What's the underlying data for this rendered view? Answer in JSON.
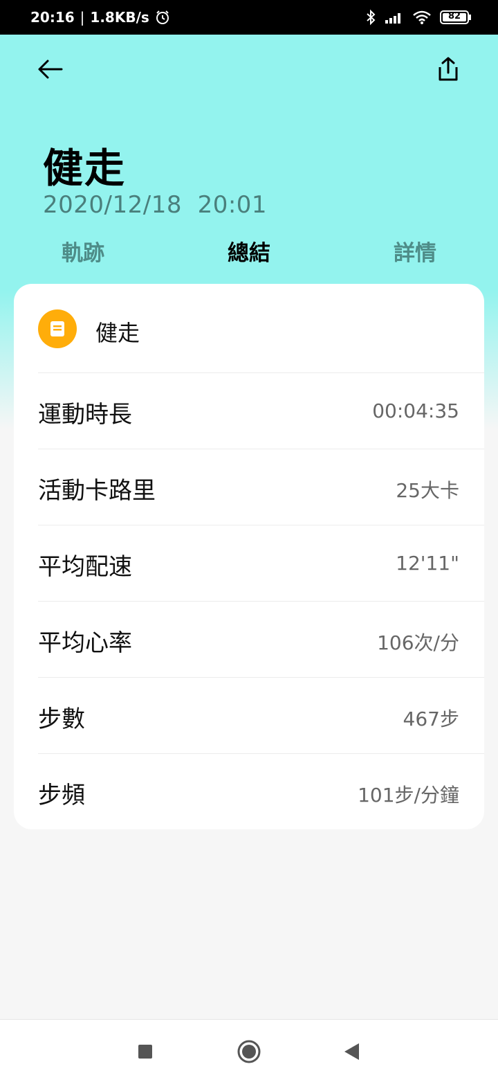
{
  "status_bar": {
    "time": "20:16",
    "separator": "|",
    "net_speed": "1.8KB/s",
    "battery": "82",
    "icons": [
      "alarm-icon",
      "bluetooth-icon",
      "signal-icon",
      "wifi-icon",
      "battery-icon"
    ]
  },
  "toolbar": {
    "back_icon": "arrow-left-icon",
    "share_icon": "share-icon"
  },
  "header": {
    "title": "健走",
    "datetime": "2020/12/18  20:01"
  },
  "tabs": [
    {
      "label": "軌跡",
      "active": false
    },
    {
      "label": "總結",
      "active": true
    },
    {
      "label": "詳情",
      "active": false
    }
  ],
  "card": {
    "activity_icon": "note-icon",
    "activity_name": "健走",
    "rows": [
      {
        "label": "運動時長",
        "value": "00:04:35"
      },
      {
        "label": "活動卡路里",
        "value": "25大卡"
      },
      {
        "label": "平均配速",
        "value": "12'11\""
      },
      {
        "label": "平均心率",
        "value": "106次/分"
      },
      {
        "label": "步數",
        "value": "467步"
      },
      {
        "label": "步頻",
        "value": "101步/分鐘"
      }
    ]
  },
  "colors": {
    "header_bg": "#93f3ee",
    "accent_orange": "#ffad0a",
    "tab_inactive": "#4e8c88"
  },
  "nav_bar": {
    "icons": [
      "recents-square-icon",
      "home-circle-icon",
      "back-triangle-icon"
    ]
  }
}
